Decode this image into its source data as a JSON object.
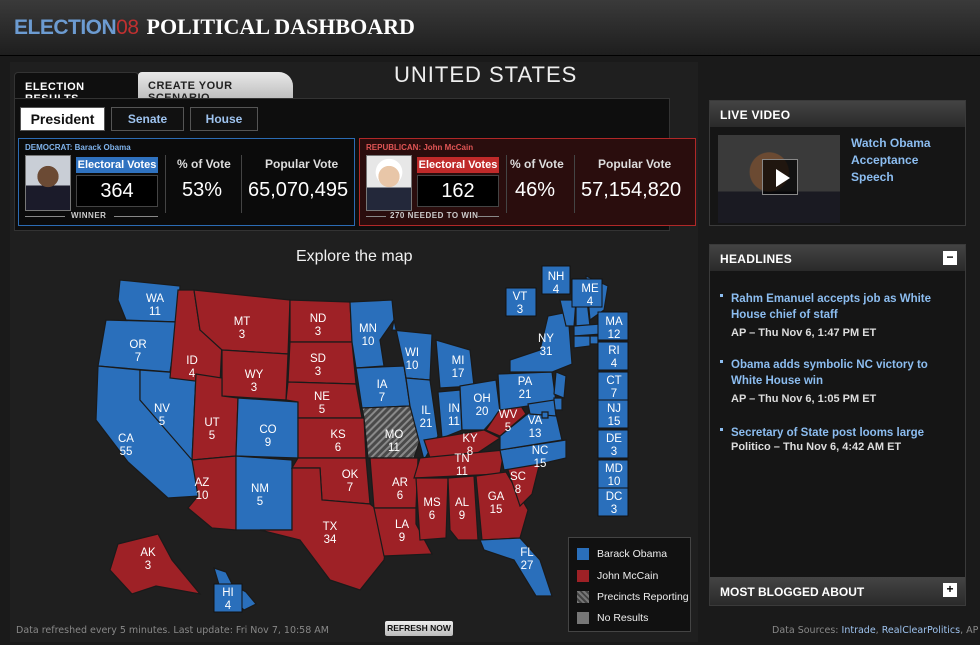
{
  "header": {
    "logo_part1": "ELECTION",
    "logo_part2": "08",
    "title": "POLITICAL DASHBOARD"
  },
  "tabs": [
    {
      "label": "ELECTION RESULTS",
      "active": true
    },
    {
      "label": "CREATE YOUR SCENARIO",
      "active": false
    }
  ],
  "country": "UNITED STATES",
  "race_buttons": [
    "President",
    "Senate",
    "House"
  ],
  "democrat": {
    "party_label": "DEMOCRAT: Barack Obama",
    "ev_label": "Electoral Votes",
    "ev": "364",
    "pct_label": "% of Vote",
    "pct": "53%",
    "pop_label": "Popular Vote",
    "pop": "65,070,495",
    "note": "WINNER"
  },
  "republican": {
    "party_label": "REPUBLICAN: John McCain",
    "ev_label": "Electoral Votes",
    "ev": "162",
    "pct_label": "% of Vote",
    "pct": "46%",
    "pop_label": "Popular Vote",
    "pop": "57,154,820",
    "note": "270 NEEDED TO WIN"
  },
  "explore": "Explore the map",
  "colors": {
    "obama": "#2a6fbb",
    "mccain": "#9e2126",
    "reporting": "#555555",
    "none": "#777777"
  },
  "states": [
    {
      "abbr": "WA",
      "ev": "11",
      "party": "obama"
    },
    {
      "abbr": "OR",
      "ev": "7",
      "party": "obama"
    },
    {
      "abbr": "CA",
      "ev": "55",
      "party": "obama"
    },
    {
      "abbr": "NV",
      "ev": "5",
      "party": "obama"
    },
    {
      "abbr": "ID",
      "ev": "4",
      "party": "mccain"
    },
    {
      "abbr": "MT",
      "ev": "3",
      "party": "mccain"
    },
    {
      "abbr": "WY",
      "ev": "3",
      "party": "mccain"
    },
    {
      "abbr": "UT",
      "ev": "5",
      "party": "mccain"
    },
    {
      "abbr": "AZ",
      "ev": "10",
      "party": "mccain"
    },
    {
      "abbr": "CO",
      "ev": "9",
      "party": "obama"
    },
    {
      "abbr": "NM",
      "ev": "5",
      "party": "obama"
    },
    {
      "abbr": "ND",
      "ev": "3",
      "party": "mccain"
    },
    {
      "abbr": "SD",
      "ev": "3",
      "party": "mccain"
    },
    {
      "abbr": "NE",
      "ev": "5",
      "party": "mccain"
    },
    {
      "abbr": "KS",
      "ev": "6",
      "party": "mccain"
    },
    {
      "abbr": "OK",
      "ev": "7",
      "party": "mccain"
    },
    {
      "abbr": "TX",
      "ev": "34",
      "party": "mccain"
    },
    {
      "abbr": "MN",
      "ev": "10",
      "party": "obama"
    },
    {
      "abbr": "IA",
      "ev": "7",
      "party": "obama"
    },
    {
      "abbr": "MO",
      "ev": "11",
      "party": "reporting"
    },
    {
      "abbr": "AR",
      "ev": "6",
      "party": "mccain"
    },
    {
      "abbr": "LA",
      "ev": "9",
      "party": "mccain"
    },
    {
      "abbr": "WI",
      "ev": "10",
      "party": "obama"
    },
    {
      "abbr": "IL",
      "ev": "21",
      "party": "obama"
    },
    {
      "abbr": "MI",
      "ev": "17",
      "party": "obama"
    },
    {
      "abbr": "IN",
      "ev": "11",
      "party": "obama"
    },
    {
      "abbr": "OH",
      "ev": "20",
      "party": "obama"
    },
    {
      "abbr": "KY",
      "ev": "8",
      "party": "mccain"
    },
    {
      "abbr": "TN",
      "ev": "11",
      "party": "mccain"
    },
    {
      "abbr": "MS",
      "ev": "6",
      "party": "mccain"
    },
    {
      "abbr": "AL",
      "ev": "9",
      "party": "mccain"
    },
    {
      "abbr": "GA",
      "ev": "15",
      "party": "mccain"
    },
    {
      "abbr": "FL",
      "ev": "27",
      "party": "obama"
    },
    {
      "abbr": "SC",
      "ev": "8",
      "party": "mccain"
    },
    {
      "abbr": "NC",
      "ev": "15",
      "party": "obama"
    },
    {
      "abbr": "VA",
      "ev": "13",
      "party": "obama"
    },
    {
      "abbr": "WV",
      "ev": "5",
      "party": "mccain"
    },
    {
      "abbr": "PA",
      "ev": "21",
      "party": "obama"
    },
    {
      "abbr": "NY",
      "ev": "31",
      "party": "obama"
    },
    {
      "abbr": "VT",
      "ev": "3",
      "party": "obama"
    },
    {
      "abbr": "NH",
      "ev": "4",
      "party": "obama"
    },
    {
      "abbr": "ME",
      "ev": "4",
      "party": "obama"
    },
    {
      "abbr": "MA",
      "ev": "12",
      "party": "obama"
    },
    {
      "abbr": "RI",
      "ev": "4",
      "party": "obama"
    },
    {
      "abbr": "CT",
      "ev": "7",
      "party": "obama"
    },
    {
      "abbr": "NJ",
      "ev": "15",
      "party": "obama"
    },
    {
      "abbr": "DE",
      "ev": "3",
      "party": "obama"
    },
    {
      "abbr": "MD",
      "ev": "10",
      "party": "obama"
    },
    {
      "abbr": "DC",
      "ev": "3",
      "party": "obama"
    },
    {
      "abbr": "AK",
      "ev": "3",
      "party": "mccain"
    },
    {
      "abbr": "HI",
      "ev": "4",
      "party": "obama"
    }
  ],
  "legend": [
    "Barack Obama",
    "John McCain",
    "Precincts Reporting",
    "No Results"
  ],
  "footer": {
    "refresh_info": "Data refreshed every 5 minutes. Last update: Fri Nov 7, 10:58 AM",
    "refresh_button": "REFRESH NOW",
    "sources_label": "Data Sources:",
    "source1": "Intrade",
    "source2": "RealClearPolitics",
    "source3": "AP"
  },
  "live_video": {
    "title": "LIVE VIDEO",
    "link": "Watch Obama Acceptance Speech"
  },
  "headlines": {
    "title": "HEADLINES",
    "toggle": "−",
    "items": [
      {
        "title": "Rahm Emanuel accepts job as White House chief of staff",
        "meta": "AP – Thu Nov 6, 1:47 PM ET"
      },
      {
        "title": "Obama adds symbolic NC victory to White House win",
        "meta": "AP – Thu Nov 6, 1:05 PM ET"
      },
      {
        "title": "Secretary of State post looms large",
        "meta": "Politico – Thu Nov 6, 4:42 AM ET"
      }
    ]
  },
  "most_blogged": {
    "title": "MOST BLOGGED ABOUT",
    "toggle": "+"
  }
}
